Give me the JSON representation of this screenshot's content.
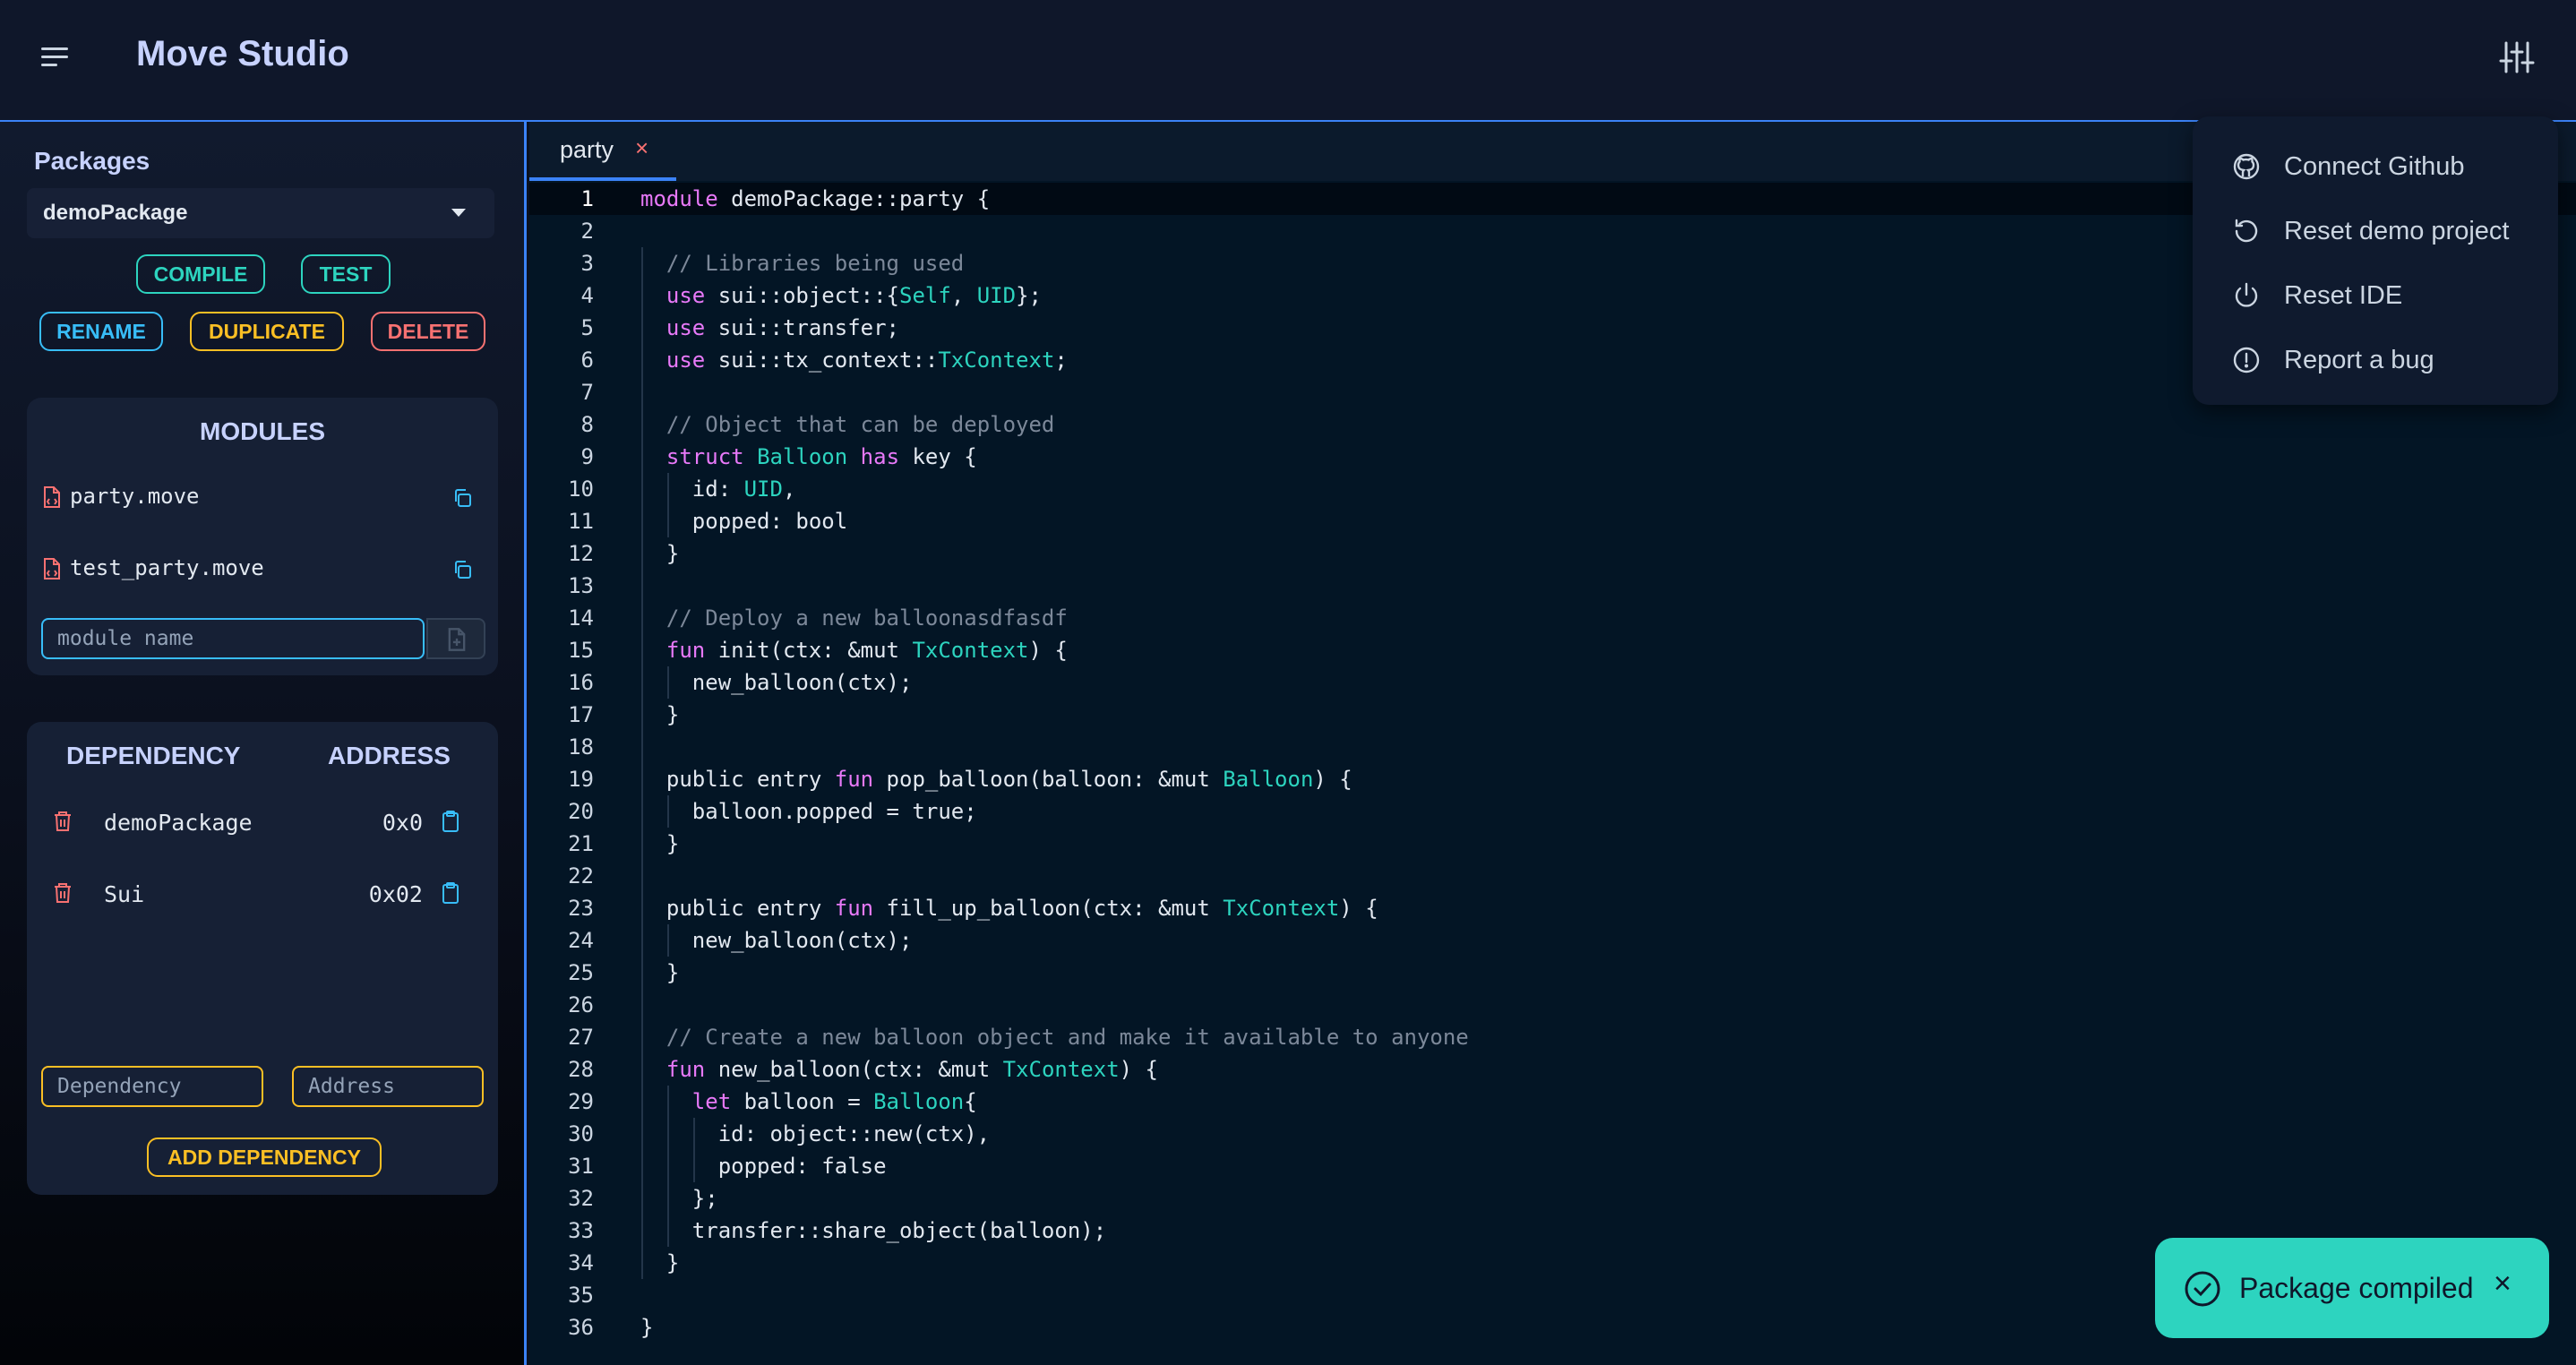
{
  "header": {
    "title": "Move Studio",
    "menu_icon": "hamburger-menu-icon",
    "settings_icon": "sliders-icon"
  },
  "sidebar": {
    "packages_title": "Packages",
    "selected_package": "demoPackage",
    "buttons": {
      "compile": "COMPILE",
      "test": "TEST",
      "rename": "RENAME",
      "duplicate": "DUPLICATE",
      "delete": "DELETE"
    },
    "modules": {
      "title": "MODULES",
      "items": [
        {
          "name": "party.move"
        },
        {
          "name": "test_party.move"
        }
      ],
      "input_placeholder": "module name"
    },
    "dependencies": {
      "col_dependency": "DEPENDENCY",
      "col_address": "ADDRESS",
      "items": [
        {
          "name": "demoPackage",
          "address": "0x0"
        },
        {
          "name": "Sui",
          "address": "0x02"
        }
      ],
      "dependency_placeholder": "Dependency",
      "address_placeholder": "Address",
      "add_label": "ADD DEPENDENCY"
    }
  },
  "editor": {
    "tab": {
      "label": "party",
      "close": "×"
    },
    "active_line": 1,
    "lines": [
      "module demoPackage::party {",
      "",
      "  // Libraries being used",
      "  use sui::object::{Self, UID};",
      "  use sui::transfer;",
      "  use sui::tx_context::TxContext;",
      "",
      "  // Object that can be deployed",
      "  struct Balloon has key {",
      "    id: UID,",
      "    popped: bool",
      "  }",
      "",
      "  // Deploy a new balloonasdfasdf",
      "  fun init(ctx: &mut TxContext) {",
      "    new_balloon(ctx);",
      "  }",
      "",
      "  public entry fun pop_balloon(balloon: &mut Balloon) {",
      "    balloon.popped = true;",
      "  }",
      "",
      "  public entry fun fill_up_balloon(ctx: &mut TxContext) {",
      "    new_balloon(ctx);",
      "  }",
      "",
      "  // Create a new balloon object and make it available to anyone",
      "  fun new_balloon(ctx: &mut TxContext) {",
      "    let balloon = Balloon{",
      "      id: object::new(ctx),",
      "      popped: false",
      "    };",
      "    transfer::share_object(balloon);",
      "  }",
      "",
      "}"
    ]
  },
  "menu": {
    "items": [
      {
        "label": "Connect Github",
        "icon": "github-icon"
      },
      {
        "label": "Reset demo project",
        "icon": "reset-icon"
      },
      {
        "label": "Reset IDE",
        "icon": "power-icon"
      },
      {
        "label": "Report a bug",
        "icon": "alert-circle-icon"
      }
    ]
  },
  "toast": {
    "message": "Package compiled",
    "close": "×",
    "icon": "check-circle-icon"
  },
  "colors": {
    "accent": "#3b82f6",
    "teal": "#2dd4bf",
    "sky": "#38bdf8",
    "amber": "#fbbf24",
    "red": "#f87171",
    "keyword": "#e879f9",
    "comment": "#7c8899"
  }
}
